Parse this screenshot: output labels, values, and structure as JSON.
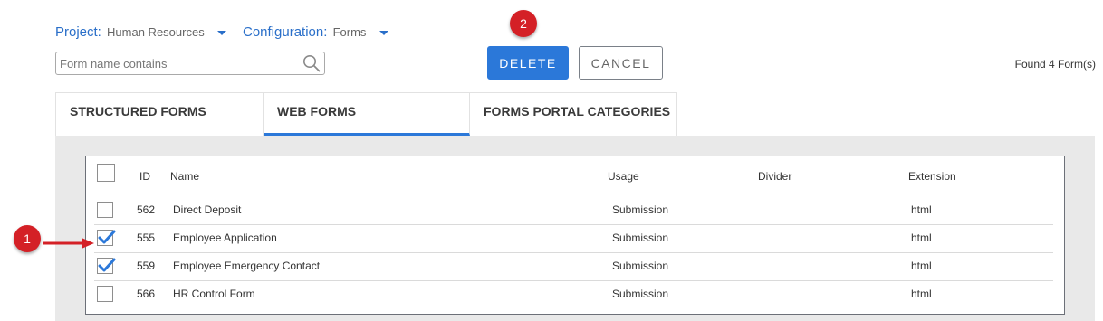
{
  "project": {
    "label": "Project:",
    "value": "Human Resources"
  },
  "configuration": {
    "label": "Configuration:",
    "value": "Forms"
  },
  "search": {
    "placeholder": "Form name contains",
    "value": ""
  },
  "buttons": {
    "delete": "DELETE",
    "cancel": "CANCEL"
  },
  "found_text": "Found 4 Form(s)",
  "tabs": [
    {
      "label": "STRUCTURED FORMS",
      "active": false
    },
    {
      "label": "WEB FORMS",
      "active": true
    },
    {
      "label": "FORMS PORTAL CATEGORIES",
      "active": false
    }
  ],
  "table": {
    "headers": {
      "id": "ID",
      "name": "Name",
      "usage": "Usage",
      "divider": "Divider",
      "extension": "Extension"
    },
    "rows": [
      {
        "id": "562",
        "name": "Direct Deposit",
        "usage": "Submission",
        "divider": "",
        "extension": "html",
        "checked": false
      },
      {
        "id": "555",
        "name": "Employee Application",
        "usage": "Submission",
        "divider": "",
        "extension": "html",
        "checked": true
      },
      {
        "id": "559",
        "name": "Employee Emergency Contact",
        "usage": "Submission",
        "divider": "",
        "extension": "html",
        "checked": true
      },
      {
        "id": "566",
        "name": "HR Control Form",
        "usage": "Submission",
        "divider": "",
        "extension": "html",
        "checked": false
      }
    ]
  },
  "callouts": {
    "one": "1",
    "two": "2"
  },
  "colors": {
    "accent": "#2b78d9",
    "callout": "#d42026",
    "link": "#2a6fc9"
  },
  "icons": {
    "search": "search-icon",
    "caret": "caret-down-icon",
    "check": "checkmark-icon",
    "arrow": "arrow-right-icon"
  }
}
